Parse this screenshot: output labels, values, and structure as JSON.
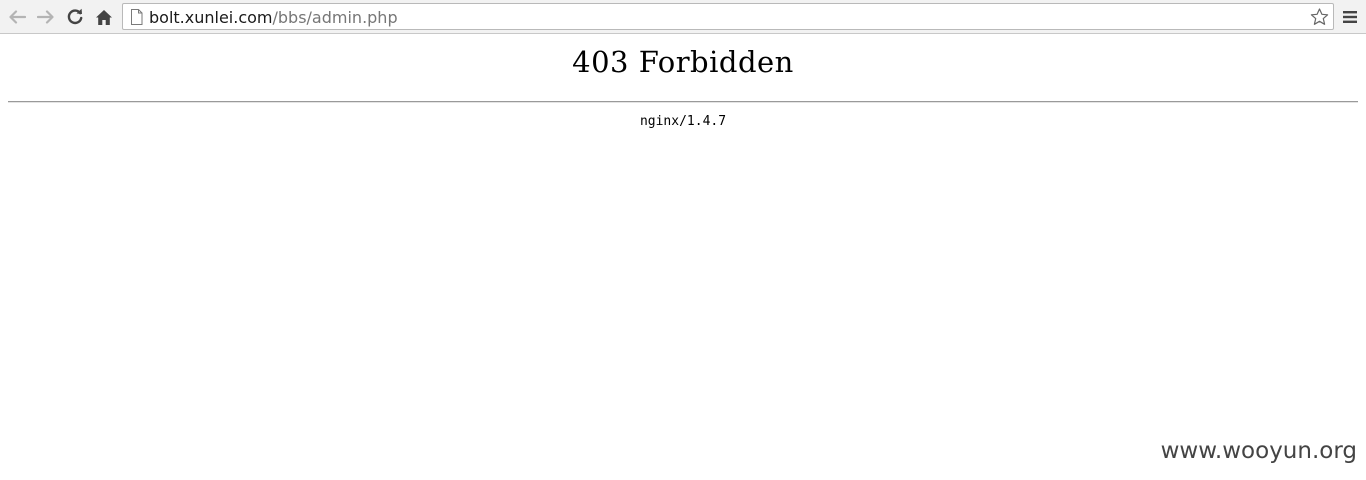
{
  "browser": {
    "address": {
      "host": "bolt.xunlei.com",
      "path": "/bbs/admin.php"
    },
    "icons": {
      "back": "arrow-left-icon",
      "forward": "arrow-right-icon",
      "reload": "reload-icon",
      "home": "home-icon",
      "page": "page-icon",
      "bookmark": "star-icon",
      "menu": "hamburger-menu-icon"
    }
  },
  "page": {
    "title": "403 Forbidden",
    "server": "nginx/1.4.7"
  },
  "watermark": "www.wooyun.org",
  "colors": {
    "toolbar": "#f2f2f2",
    "url_host": "#1a1a1a",
    "url_path": "#777777",
    "icon_active": "#444444",
    "icon_disabled": "#b4b4b4",
    "rule": "#9a9a9a",
    "watermark": "#444444"
  }
}
